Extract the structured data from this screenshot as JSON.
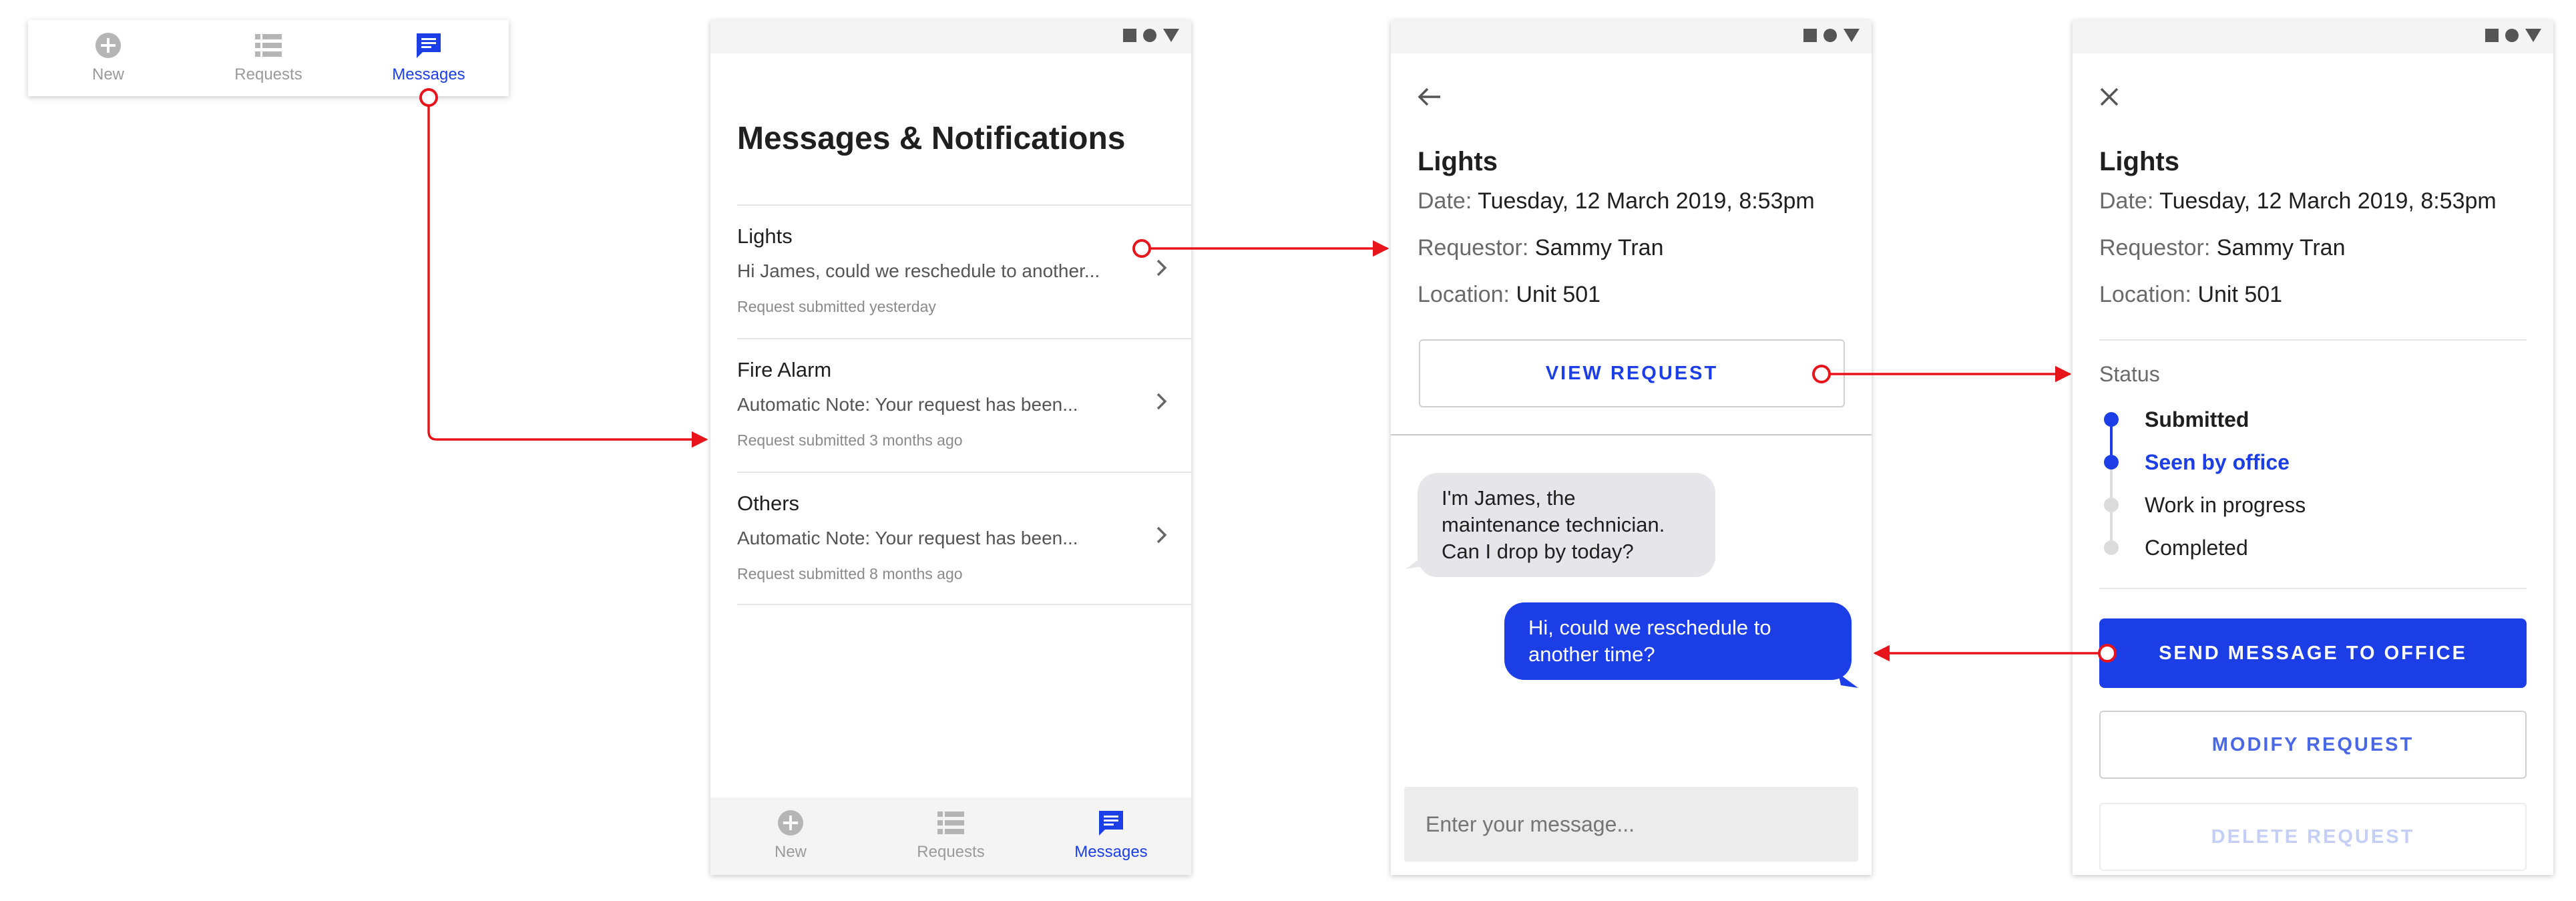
{
  "colors": {
    "accent": "#1c3ee6",
    "arrow": "#e8141b"
  },
  "mini_tabbar": {
    "tabs": [
      {
        "label": "New",
        "icon": "plus-circle-icon"
      },
      {
        "label": "Requests",
        "icon": "list-icon"
      },
      {
        "label": "Messages",
        "icon": "chat-icon"
      }
    ]
  },
  "screen_list": {
    "title": "Messages & Notifications",
    "items": [
      {
        "title": "Lights",
        "preview": "Hi James, could we reschedule to another...",
        "meta": "Request submitted yesterday"
      },
      {
        "title": "Fire Alarm",
        "preview": "Automatic Note: Your request has been...",
        "meta": "Request submitted 3 months ago"
      },
      {
        "title": "Others",
        "preview": "Automatic Note: Your request has been...",
        "meta": "Request submitted 8 months ago"
      }
    ],
    "tabbar": {
      "tabs": [
        {
          "label": "New",
          "icon": "plus-circle-icon"
        },
        {
          "label": "Requests",
          "icon": "list-icon"
        },
        {
          "label": "Messages",
          "icon": "chat-icon"
        }
      ]
    }
  },
  "screen_chat": {
    "title": "Lights",
    "date_label": "Date:",
    "date_value": "Tuesday, 12 March 2019, 8:53pm",
    "requestor_label": "Requestor:",
    "requestor_value": "Sammy Tran",
    "location_label": "Location:",
    "location_value": "Unit 501",
    "view_button": "VIEW REQUEST",
    "messages": [
      {
        "from": "technician",
        "text": "I'm James, the maintenance technician. Can I drop by today?"
      },
      {
        "from": "user",
        "text": "Hi, could we reschedule to another time?"
      }
    ],
    "input_placeholder": "Enter your message..."
  },
  "screen_detail": {
    "title": "Lights",
    "date_label": "Date:",
    "date_value": "Tuesday, 12 March 2019, 8:53pm",
    "requestor_label": "Requestor:",
    "requestor_value": "Sammy Tran",
    "location_label": "Location:",
    "location_value": "Unit 501",
    "status_label": "Status",
    "steps": [
      {
        "label": "Submitted",
        "state": "done"
      },
      {
        "label": "Seen by office",
        "state": "current"
      },
      {
        "label": "Work in progress",
        "state": "pending"
      },
      {
        "label": "Completed",
        "state": "pending"
      }
    ],
    "send_button": "SEND MESSAGE TO OFFICE",
    "modify_button": "MODIFY REQUEST",
    "delete_button": "DELETE REQUEST"
  }
}
